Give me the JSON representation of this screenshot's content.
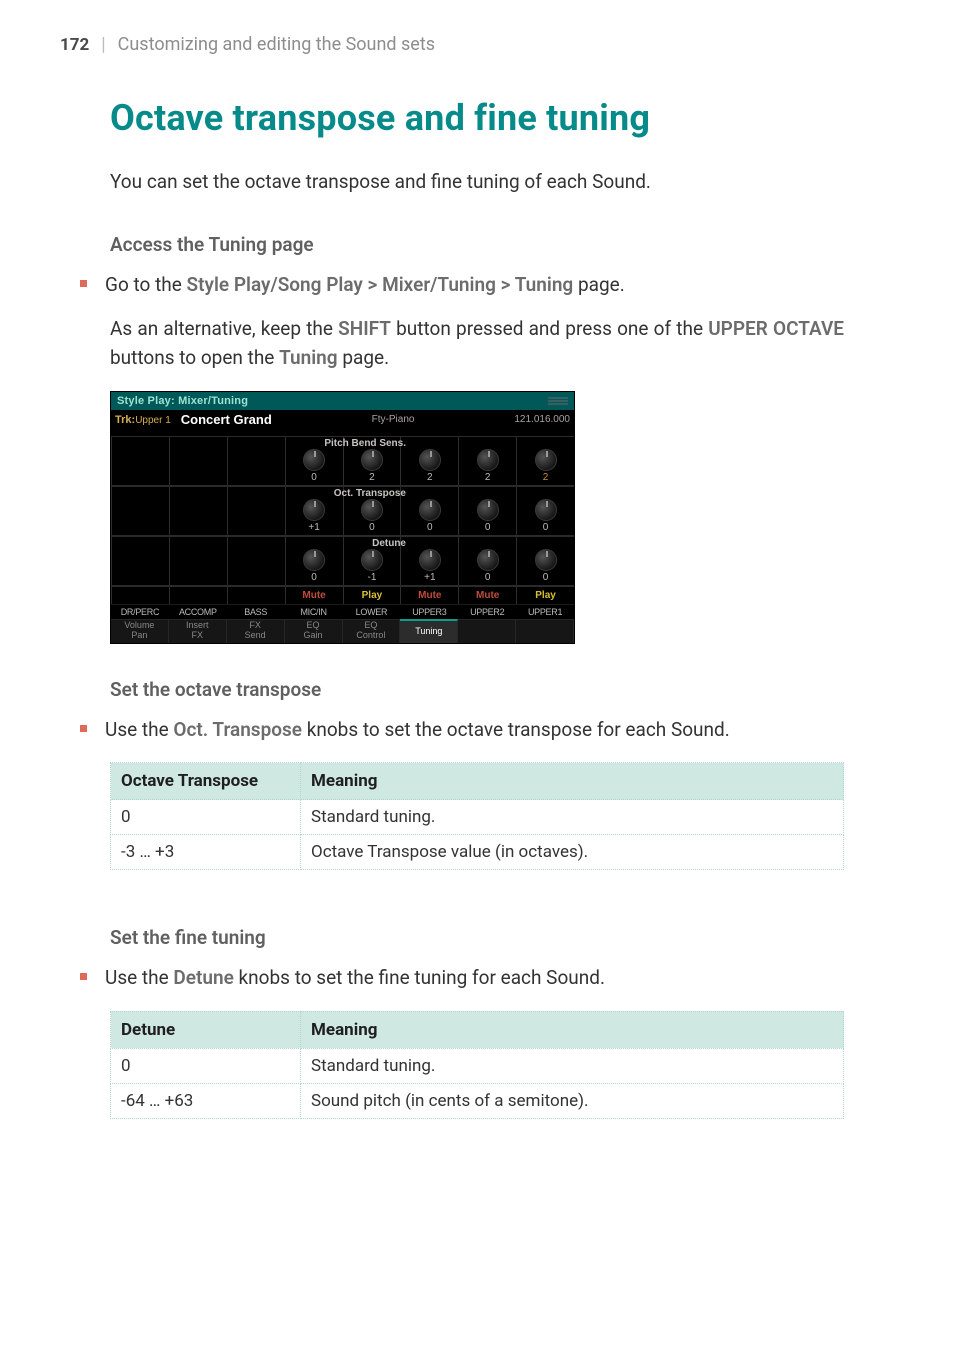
{
  "page_header": {
    "page_number": "172",
    "separator": "|",
    "chapter": "Customizing and editing the Sound sets"
  },
  "h1": "Octave transpose and fine tuning",
  "intro": "You can set the octave transpose and fine tuning of each Sound.",
  "access_tuning": {
    "heading": "Access the Tuning page",
    "bullet_pre": "Go to the ",
    "bullet_path": "Style Play/Song Play > Mixer/Tuning > Tuning",
    "bullet_post": " page.",
    "alt_pre": "As an alternative, keep the ",
    "alt_shift": "SHIFT",
    "alt_mid": " button pressed and press one of the ",
    "alt_upper": "UPPER OCTAVE",
    "alt_mid2": " buttons to open the ",
    "alt_tuning": "Tuning",
    "alt_post": " page."
  },
  "device": {
    "titlebar": "Style Play: Mixer/Tuning",
    "trk_label": "Trk:",
    "trk_value": "Upper 1",
    "preset": "Concert Grand",
    "family": "Fty-Piano",
    "program_id": "121.016.000",
    "rows": {
      "pbs": {
        "label": "Pitch Bend Sens.",
        "values": [
          "",
          "",
          "",
          "0",
          "2",
          "2",
          "2",
          "2"
        ],
        "active_col": 7
      },
      "oct": {
        "label": "Oct. Transpose",
        "values": [
          "",
          "",
          "",
          "+1",
          "0",
          "0",
          "0",
          "0"
        ],
        "active_col": -1
      },
      "det": {
        "label": "Detune",
        "values": [
          "",
          "",
          "",
          "0",
          "-1",
          "+1",
          "0",
          "0"
        ],
        "active_col": -1
      }
    },
    "muteplay": [
      "",
      "",
      "",
      "Mute",
      "Play",
      "Mute",
      "Mute",
      "Play"
    ],
    "muteplay_kind": [
      "",
      "",
      "",
      "mute",
      "play",
      "mute",
      "mute",
      "play"
    ],
    "tracklabels": [
      "DR/PERC",
      "ACCOMP",
      "BASS",
      "MIC/IN",
      "LOWER",
      "UPPER3",
      "UPPER2",
      "UPPER1"
    ],
    "tabs": [
      "Volume\nPan",
      "Insert\nFX",
      "FX\nSend",
      "EQ\nGain",
      "EQ\nControl",
      "Tuning",
      "",
      ""
    ],
    "active_tab": 5
  },
  "octave": {
    "heading": "Set the octave transpose",
    "bullet_pre": "Use the ",
    "bullet_knob": "Oct. Transpose",
    "bullet_post": " knobs to set the octave transpose for each Sound.",
    "table": {
      "head_key": "Octave Transpose",
      "head_meaning": "Meaning",
      "rows": [
        {
          "key": "0",
          "meaning": "Standard tuning."
        },
        {
          "key": "-3 … +3",
          "meaning": "Octave Transpose value (in octaves)."
        }
      ]
    }
  },
  "detune": {
    "heading": "Set the fine tuning",
    "bullet_pre": "Use the ",
    "bullet_knob": "Detune",
    "bullet_post": " knobs to set the fine tuning for each Sound.",
    "table": {
      "head_key": "Detune",
      "head_meaning": "Meaning",
      "rows": [
        {
          "key": "0",
          "meaning": "Standard tuning."
        },
        {
          "key": "-64 … +63",
          "meaning": "Sound pitch (in cents of a semitone)."
        }
      ]
    }
  }
}
